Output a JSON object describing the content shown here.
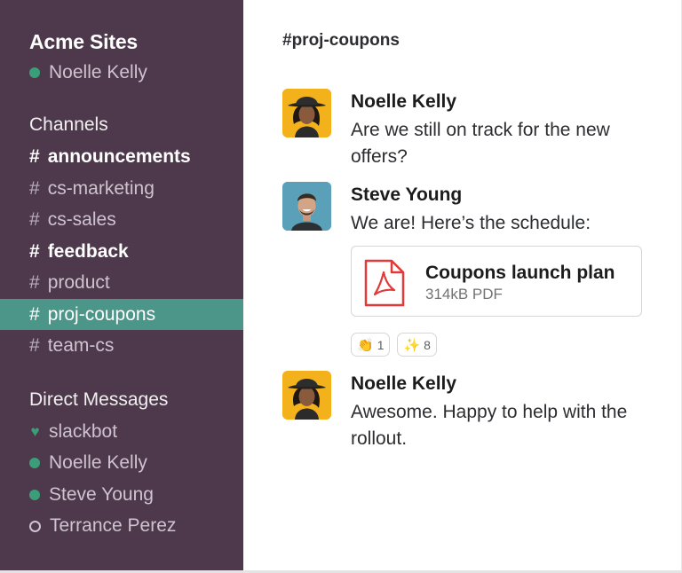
{
  "sidebar": {
    "team_name": "Acme Sites",
    "current_user": "Noelle Kelly",
    "channels_header": "Channels",
    "channels": [
      {
        "name": "announcements",
        "unread": true,
        "active": false
      },
      {
        "name": "cs-marketing",
        "unread": false,
        "active": false
      },
      {
        "name": "cs-sales",
        "unread": false,
        "active": false
      },
      {
        "name": "feedback",
        "unread": true,
        "active": false
      },
      {
        "name": "product",
        "unread": false,
        "active": false
      },
      {
        "name": "proj-coupons",
        "unread": false,
        "active": true
      },
      {
        "name": "team-cs",
        "unread": false,
        "active": false
      }
    ],
    "channel_prefix": "#",
    "dm_header": "Direct Messages",
    "direct_messages": [
      {
        "name": "slackbot",
        "status": "heart-icon"
      },
      {
        "name": "Noelle Kelly",
        "status": "online"
      },
      {
        "name": "Steve Young",
        "status": "online"
      },
      {
        "name": "Terrance Perez",
        "status": "away"
      }
    ]
  },
  "main": {
    "channel_title": "#proj-coupons",
    "messages": [
      {
        "author": "Noelle Kelly",
        "text": "Are we still on track for the new offers?",
        "avatar": "noelle-avatar"
      },
      {
        "author": "Steve Young",
        "text": "We are! Here’s the schedule:",
        "avatar": "steve-avatar",
        "file": {
          "name": "Coupons launch plan",
          "meta": "314kB PDF",
          "icon": "pdf-icon"
        },
        "reactions": [
          {
            "emoji": "👏",
            "count": "1"
          },
          {
            "emoji": "✨",
            "count": "8"
          }
        ]
      },
      {
        "author": "Noelle Kelly",
        "text": "Awesome. Happy to help with the rollout.",
        "avatar": "noelle-avatar"
      }
    ]
  },
  "colors": {
    "sidebar_bg": "#4d394b",
    "active_channel_bg": "#4c9689",
    "presence_online": "#3a9e78",
    "pdf_red": "#e03a3a"
  }
}
